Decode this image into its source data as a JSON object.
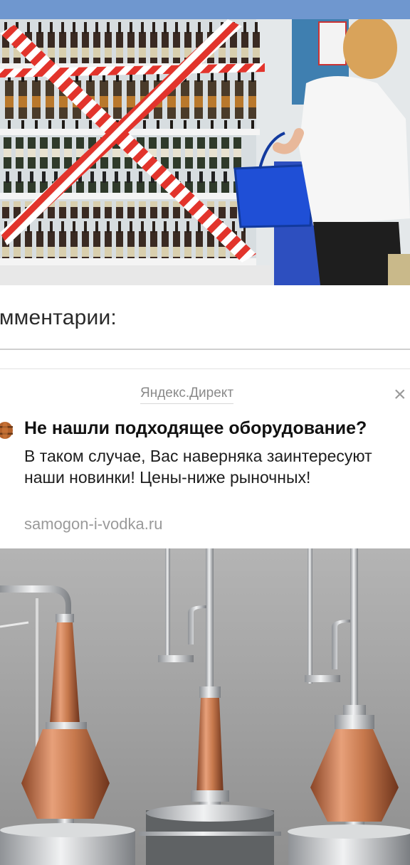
{
  "colors": {
    "top_bar": "#6f97cf",
    "title_text": "#111111",
    "muted_text": "#9a9a9a",
    "copper": "#c7794d"
  },
  "comments": {
    "heading": "ммментарии:"
  },
  "ad": {
    "source_label": "Яндекс.Директ",
    "close_icon": "×",
    "favicon": "barrel-favicon-icon",
    "title": "Не нашли подходящее оборудование?",
    "body": "В таком случае, Вас наверняка заинтересуют наши новинки! Цены-ниже рыночных!",
    "domain": "samogon-i-vodka.ru"
  }
}
